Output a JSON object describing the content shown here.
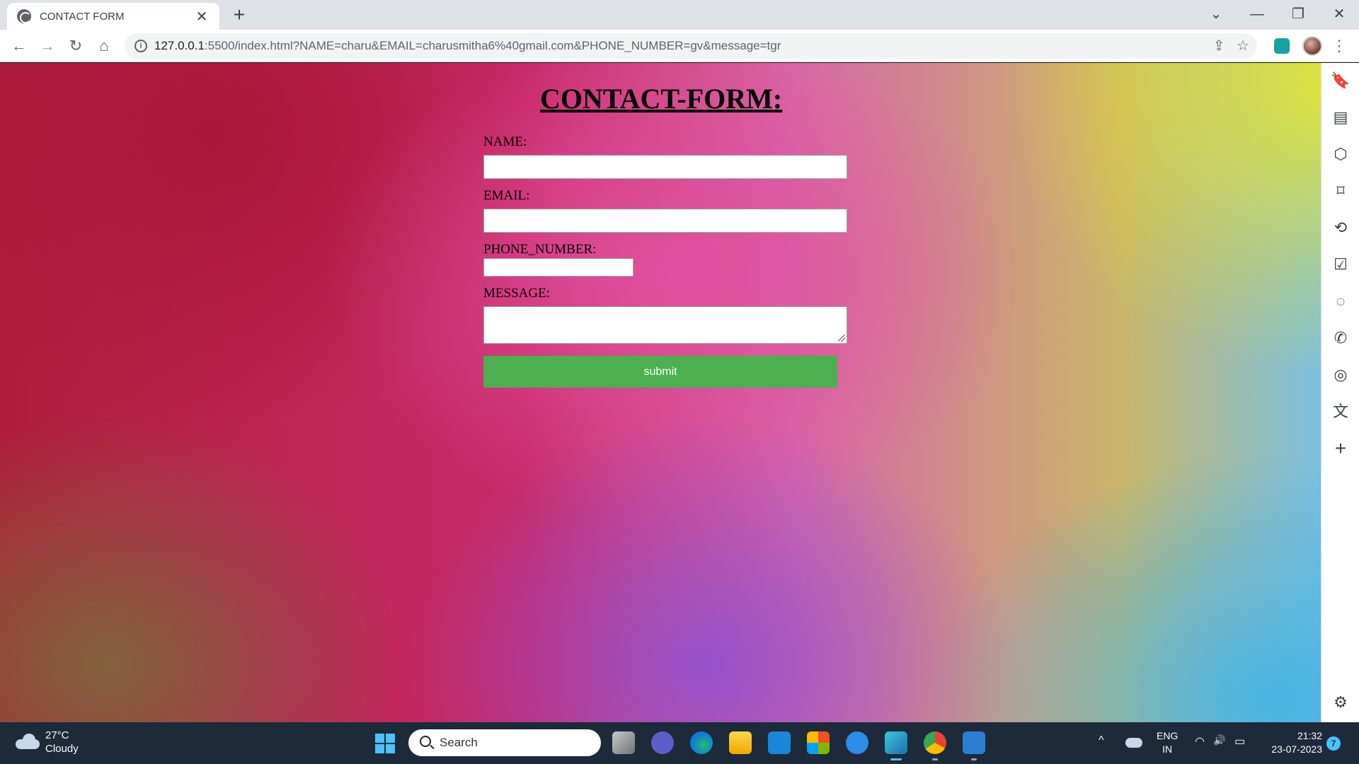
{
  "browser": {
    "tab": {
      "title": "CONTACT FORM",
      "close": "✕"
    },
    "new_tab": "+",
    "window_controls": {
      "tab_search": "⌄",
      "minimize": "—",
      "restore": "❐",
      "close": "✕"
    },
    "nav": {
      "back": "←",
      "forward": "→",
      "reload": "↻",
      "home": "⌂"
    },
    "url": {
      "host": "127.0.0.1",
      "rest": ":5500/index.html?NAME=charu&EMAIL=charusmitha6%40gmail.com&PHONE_NUMBER=gv&message=tgr"
    },
    "omnibox_icons": {
      "info": "i",
      "share": "⇪",
      "bookmark_star": "☆"
    },
    "menu": "⋮"
  },
  "page": {
    "title": "CONTACT-FORM:",
    "fields": {
      "name": {
        "label": "NAME:",
        "value": ""
      },
      "email": {
        "label": "EMAIL:",
        "value": ""
      },
      "phone": {
        "label": "PHONE_NUMBER:",
        "value": ""
      },
      "message": {
        "label": "MESSAGE:",
        "value": ""
      }
    },
    "submit_label": "submit"
  },
  "side_panel": {
    "icons": [
      "bookmark-icon",
      "reading-list-icon",
      "cube-icon",
      "tag-icon",
      "sync-icon",
      "checklist-icon",
      "messenger-icon",
      "whatsapp-icon",
      "instagram-icon",
      "translate-icon",
      "add-icon",
      "settings-icon"
    ],
    "glyphs": {
      "bookmark": "🔖",
      "reading": "▤",
      "cube": "⬡",
      "tag": "⌑",
      "sync": "⟲",
      "check": "☑",
      "messenger": "◌",
      "whatsapp": "✆",
      "instagram": "◎",
      "translate": "文",
      "add": "+",
      "settings": "⚙"
    }
  },
  "taskbar": {
    "weather": {
      "temp": "27°C",
      "desc": "Cloudy"
    },
    "search_placeholder": "Search",
    "tray": {
      "chevron": "^",
      "lang_top": "ENG",
      "lang_bottom": "IN",
      "wifi": "◠",
      "volume": "🔊",
      "battery": "▭"
    },
    "clock": {
      "time": "21:32",
      "date": "23-07-2023"
    },
    "notifications": "7"
  },
  "colors": {
    "submit_button": "#4caf50",
    "taskbar": "#1c2a3a",
    "accent": "#4cc2ff"
  }
}
